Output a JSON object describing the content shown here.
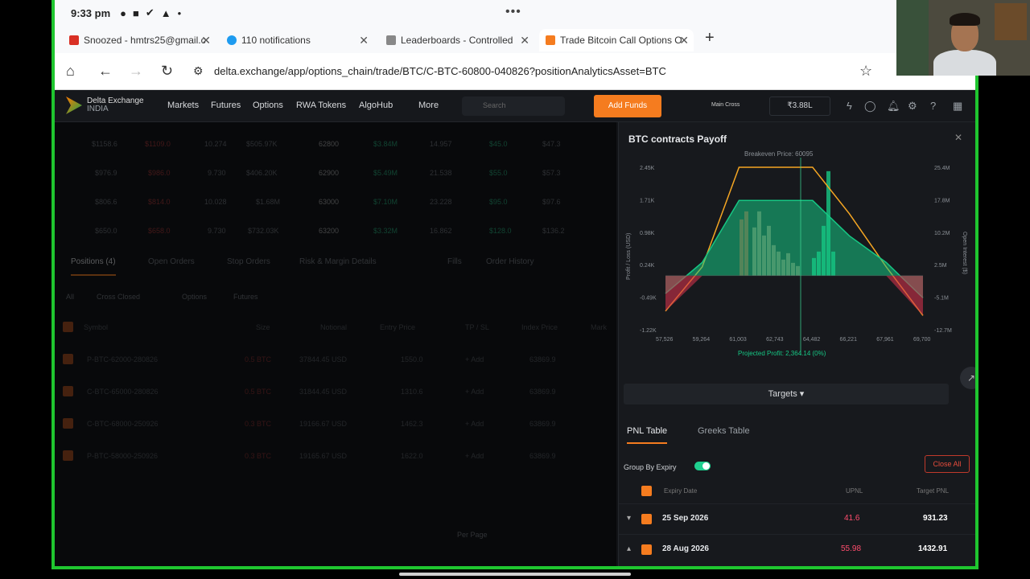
{
  "status": {
    "time": "9:33 pm"
  },
  "tabs": [
    {
      "label": "Snoozed - hmtrs25@gmail.c",
      "icon": "gmail-icon",
      "color": "#d93025"
    },
    {
      "label": "110 notifications",
      "icon": "notifications-icon",
      "color": "#1d9bf0"
    },
    {
      "label": "Leaderboards - Controlled",
      "icon": "leaderboard-icon",
      "color": "#888888"
    },
    {
      "label": "Trade Bitcoin Call Options O",
      "icon": "delta-icon",
      "color": "#f57c1f"
    }
  ],
  "url": "delta.exchange/app/options_chain/trade/BTC/C-BTC-60800-040826?positionAnalyticsAsset=BTC",
  "nav": {
    "brand": "Delta Exchange",
    "brand_region": "INDIA",
    "items": [
      "Markets",
      "Futures",
      "Options",
      "RWA Tokens",
      "AlgoHub",
      "More"
    ],
    "search_placeholder": "Search",
    "add_funds": "Add Funds",
    "account_margin": "Main Cross",
    "wallet": "₹3.88L"
  },
  "chain_rows": [
    {
      "c1": "$1158.6",
      "c2": "$1109.0",
      "c3": "10.274",
      "c4": "$505.97K",
      "strike": "62800",
      "c6": "$3.84M",
      "c7": "14.957",
      "c8": "$45.0",
      "c9": "$47.3"
    },
    {
      "c1": "$976.9",
      "c2": "$986.0",
      "c3": "9.730",
      "c4": "$406.20K",
      "strike": "62900",
      "c6": "$5.49M",
      "c7": "21.538",
      "c8": "$55.0",
      "c9": "$57.3"
    },
    {
      "c1": "$806.6",
      "c2": "$814.0",
      "c3": "10.028",
      "c4": "$1.68M",
      "strike": "63000",
      "c6": "$7.10M",
      "c7": "23.228",
      "c8": "$95.0",
      "c9": "$97.6"
    },
    {
      "c1": "$650.0",
      "c2": "$658.0",
      "c3": "9.730",
      "c4": "$732.03K",
      "strike": "63200",
      "c6": "$3.32M",
      "c7": "16.862",
      "c8": "$128.0",
      "c9": "$136.2"
    }
  ],
  "position_tabs": [
    "Positions (4)",
    "Open Orders",
    "Stop Orders",
    "Risk & Margin Details",
    "Fills",
    "Order History"
  ],
  "position_filters": [
    "All",
    "Cross Closed",
    "Options",
    "Futures"
  ],
  "position_headers": [
    "Symbol",
    "Size",
    "Notional",
    "Entry Price",
    "TP / SL",
    "Index Price",
    "Mark"
  ],
  "positions": [
    {
      "symbol": "P-BTC-62000-280826",
      "size": "0.5 BTC",
      "notional": "37844.45 USD",
      "entry": "1550.0",
      "tpsl": "+ Add",
      "index": "63869.9"
    },
    {
      "symbol": "C-BTC-65000-280826",
      "size": "0.5 BTC",
      "notional": "31844.45 USD",
      "entry": "1310.6",
      "tpsl": "+ Add",
      "index": "63869.9"
    },
    {
      "symbol": "C-BTC-68000-250926",
      "size": "0.3 BTC",
      "notional": "19166.67 USD",
      "entry": "1462.3",
      "tpsl": "+ Add",
      "index": "63869.9"
    },
    {
      "symbol": "P-BTC-58000-250926",
      "size": "0.3 BTC",
      "notional": "19165.67 USD",
      "entry": "1622.0",
      "tpsl": "+ Add",
      "index": "63869.9"
    }
  ],
  "pagination": "Per Page",
  "payoff": {
    "title": "BTC contracts Payoff",
    "breakeven_label": "Breakeven Price: 60095",
    "y_left_label": "Profit / Loss (USD)",
    "y_right_label": "Open Interest ($)",
    "y_left_ticks": [
      "2.45K",
      "1.71K",
      "0.98K",
      "0.24K",
      "-0.49K",
      "-1.22K"
    ],
    "y_right_ticks": [
      "25.4M",
      "17.8M",
      "10.2M",
      "2.5M",
      "-5.1M",
      "-12.7M"
    ],
    "x_ticks": [
      "57,526",
      "59,264",
      "61,003",
      "62,743",
      "64,482",
      "66,221",
      "67,961",
      "69,700"
    ],
    "projected_profit": "Projected Profit: 2,364.14 (0%)"
  },
  "targets_label": "Targets ▾",
  "pnl_tabs": [
    "PNL Table",
    "Greeks Table"
  ],
  "group_by_expiry": "Group By Expiry",
  "close_all": "Close All",
  "table_headers": {
    "expiry": "Expiry Date",
    "upnl": "UPNL",
    "target": "Target PNL"
  },
  "table_rows": [
    {
      "date": "25 Sep 2026",
      "upnl": "41.6",
      "target": "931.23",
      "caret": "▾"
    },
    {
      "date": "28 Aug 2026",
      "upnl": "55.98",
      "target": "1432.91",
      "caret": "▴"
    }
  ],
  "chart_data": {
    "type": "area",
    "title": "BTC contracts Payoff",
    "xlabel": "",
    "ylabel": "Profit / Loss (USD)",
    "x": [
      57526,
      59264,
      61003,
      62743,
      64482,
      66221,
      67961,
      69700
    ],
    "series": [
      {
        "values": [
          -800,
          200,
          2450,
          2450,
          2450,
          1400,
          200,
          -900
        ]
      },
      {
        "values": [
          -400,
          300,
          1700,
          1700,
          1700,
          900,
          300,
          -500
        ]
      }
    ],
    "ylim": [
      -1220,
      2450
    ],
    "xlim": [
      57526,
      69700
    ]
  }
}
